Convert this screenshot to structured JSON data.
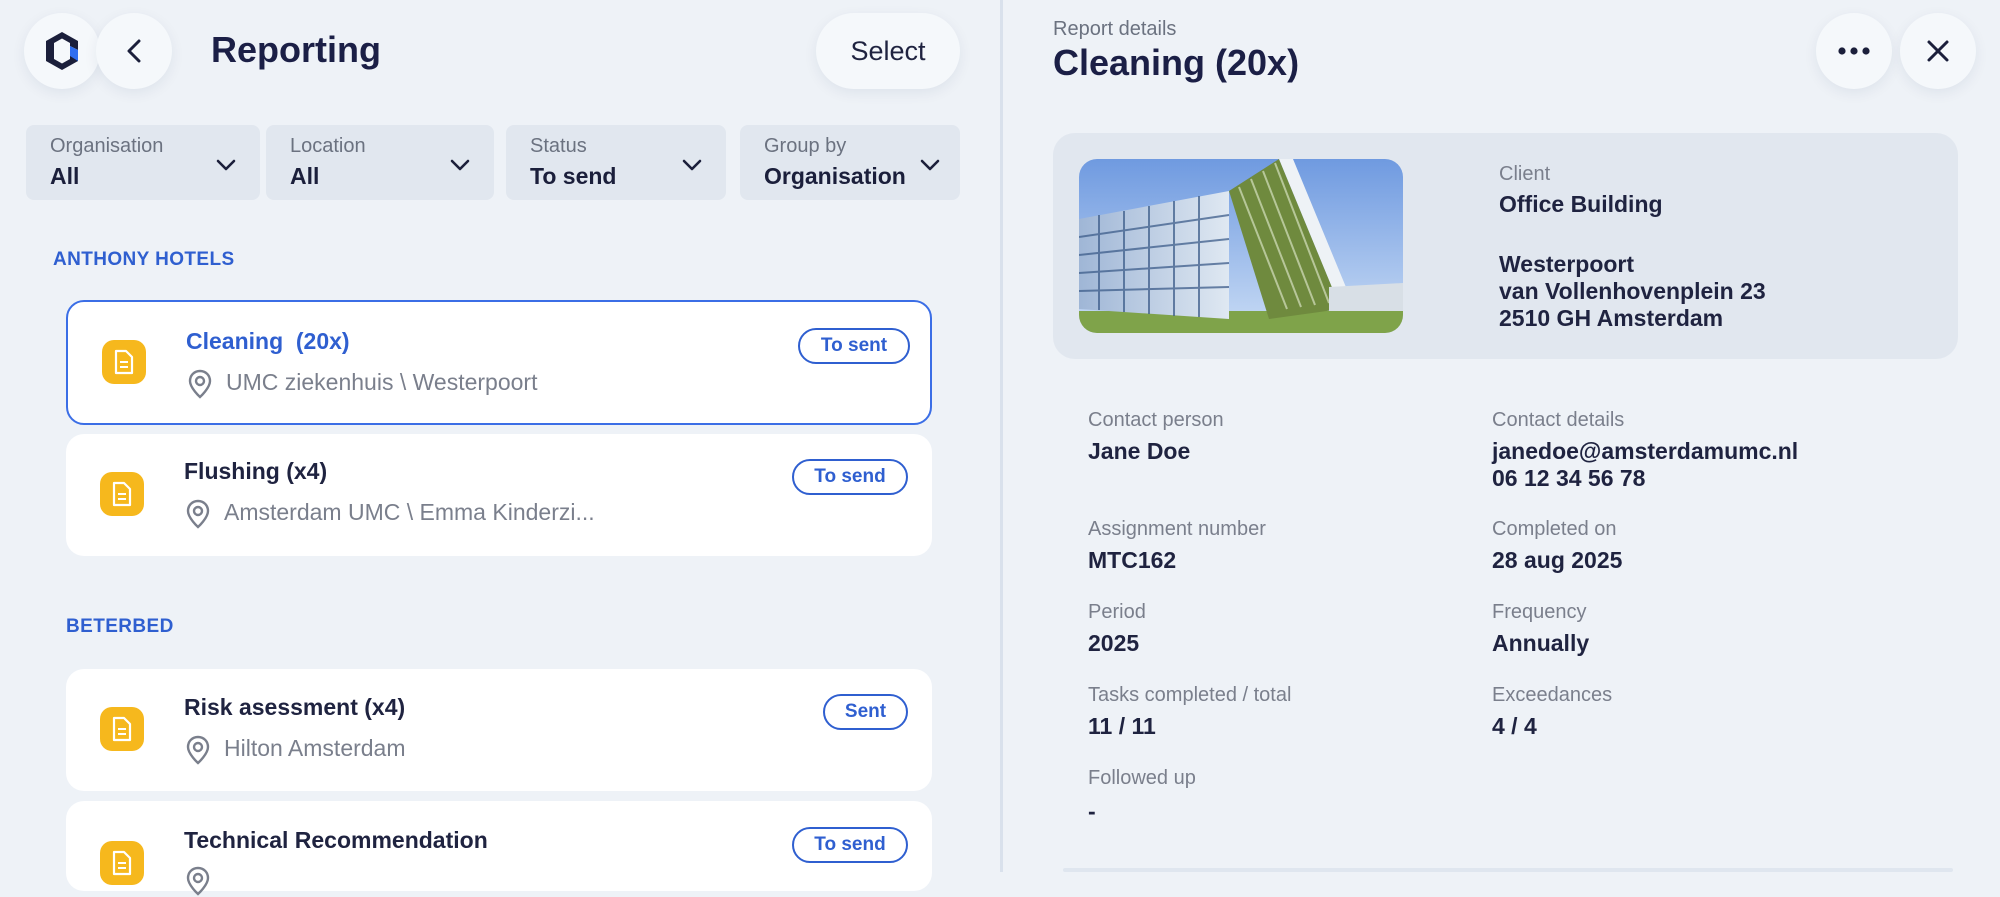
{
  "header": {
    "title": "Reporting",
    "select_label": "Select"
  },
  "filters": [
    {
      "label": "Organisation",
      "value": "All"
    },
    {
      "label": "Location",
      "value": "All"
    },
    {
      "label": "Status",
      "value": "To send"
    },
    {
      "label": "Group by",
      "value": "Organisation"
    }
  ],
  "groups": [
    {
      "name": "ANTHONY HOTELS",
      "items": [
        {
          "title": "Cleaning  (20x)",
          "location": "UMC ziekenhuis \\ Westerpoort",
          "status": "To sent"
        },
        {
          "title": "Flushing (x4)",
          "location": "Amsterdam UMC \\ Emma Kinderzi...",
          "status": "To send"
        }
      ]
    },
    {
      "name": "BETERBED",
      "items": [
        {
          "title": "Risk asessment (x4)",
          "location": "Hilton Amsterdam",
          "status": "Sent"
        },
        {
          "title": "Technical Recommendation",
          "location": "",
          "status": "To send"
        }
      ]
    }
  ],
  "details": {
    "section_label": "Report details",
    "title": "Cleaning (20x)",
    "client": {
      "label": "Client",
      "name": "Office Building",
      "address_line1": "Westerpoort",
      "address_line2": "van Vollenhovenplein 23",
      "address_line3": "2510 GH Amsterdam"
    },
    "fields": {
      "contact_person": {
        "label": "Contact person",
        "value": "Jane Doe"
      },
      "contact_details": {
        "label": "Contact details",
        "email": "janedoe@amsterdamumc.nl",
        "phone": "06 12 34 56 78"
      },
      "assignment_number": {
        "label": "Assignment number",
        "value": "MTC162"
      },
      "completed_on": {
        "label": "Completed on",
        "value": "28 aug 2025"
      },
      "period": {
        "label": "Period",
        "value": "2025"
      },
      "frequency": {
        "label": "Frequency",
        "value": "Annually"
      },
      "tasks": {
        "label": "Tasks completed / total",
        "value": "11 / 11"
      },
      "exceedances": {
        "label": "Exceedances",
        "value": "4 / 4"
      },
      "followed_up": {
        "label": "Followed up",
        "value": "-"
      }
    }
  },
  "colors": {
    "accent": "#2f5fd0",
    "doc_icon": "#f6b81d",
    "background": "#eef2f7"
  }
}
